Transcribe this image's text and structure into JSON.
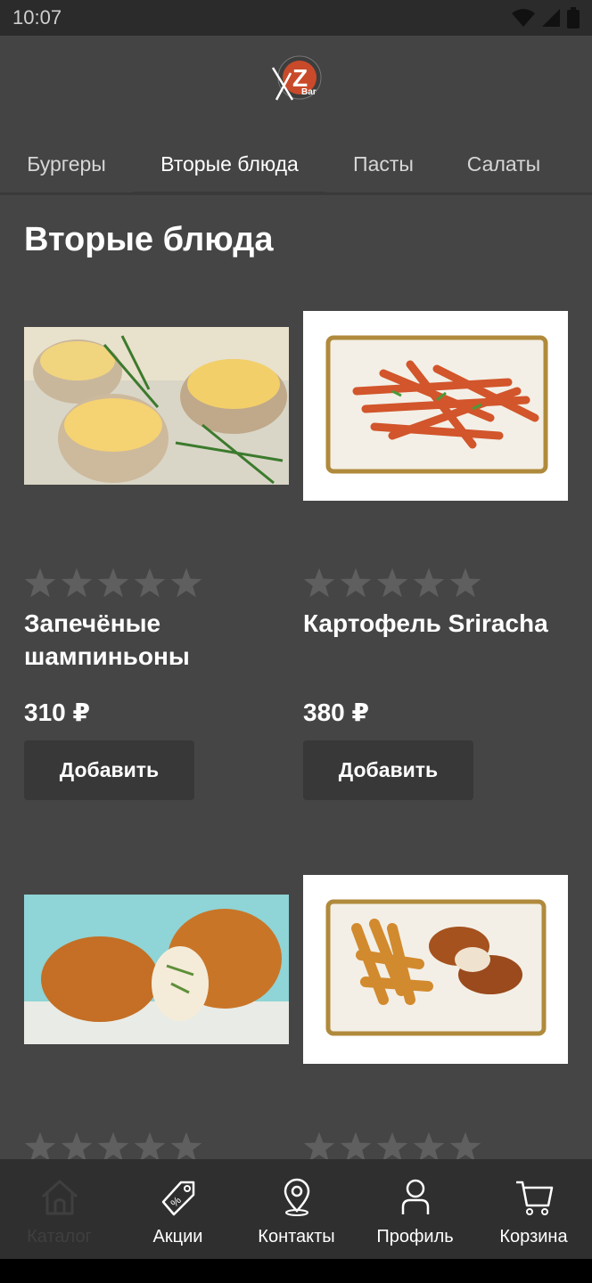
{
  "status": {
    "time": "10:07"
  },
  "tabs": [
    {
      "label": "Бургеры"
    },
    {
      "label": "Вторые блюда"
    },
    {
      "label": "Пасты"
    },
    {
      "label": "Салаты"
    }
  ],
  "page_title": "Вторые блюда",
  "products": [
    {
      "name": "Запечёные шампиньоны",
      "price": "310 ₽",
      "add_label": "Добавить",
      "rating": 0
    },
    {
      "name": "Картофель Sriracha",
      "price": "380 ₽",
      "add_label": "Добавить",
      "rating": 0
    },
    {
      "rating": 0
    },
    {
      "rating": 0
    }
  ],
  "bottom_nav": [
    {
      "label": "Каталог",
      "icon": "home-icon"
    },
    {
      "label": "Акции",
      "icon": "tag-icon"
    },
    {
      "label": "Контакты",
      "icon": "location-pin-icon"
    },
    {
      "label": "Профиль",
      "icon": "person-icon"
    },
    {
      "label": "Корзина",
      "icon": "cart-icon"
    }
  ],
  "colors": {
    "background": "#454545",
    "button": "#383838",
    "nav_bg": "#2f2f2f",
    "star": "#5f5f5f"
  }
}
